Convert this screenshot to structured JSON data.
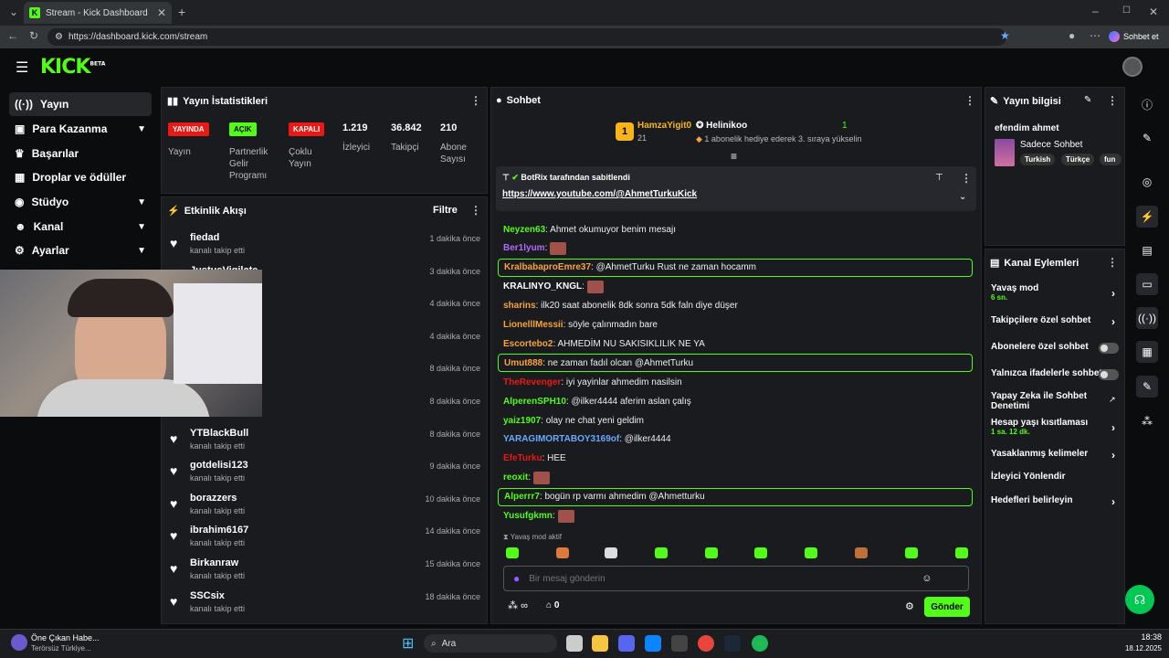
{
  "browser": {
    "tab_title": "Stream - Kick Dashboard",
    "tab_favicon": "K",
    "url": "https://dashboard.kick.com/stream",
    "chat_button": "Sohbet et"
  },
  "header": {
    "logo": "KICK",
    "logo_badge": "BETA"
  },
  "sidebar": {
    "items": [
      {
        "label": "Yayın",
        "icon": "broadcast-icon"
      },
      {
        "label": "Para Kazanma",
        "icon": "wallet-icon"
      },
      {
        "label": "Başarılar",
        "icon": "trophy-icon"
      },
      {
        "label": "Droplar ve ödüller",
        "icon": "gift-icon"
      },
      {
        "label": "Stüdyo",
        "icon": "palette-icon"
      },
      {
        "label": "Kanal",
        "icon": "people-icon"
      },
      {
        "label": "Ayarlar",
        "icon": "gear-icon"
      }
    ]
  },
  "stats": {
    "title": "Yayın İstatistikleri",
    "badges": [
      {
        "text": "YAYINDA",
        "label": "Yayın",
        "color": "#e91916"
      },
      {
        "text": "AÇIK",
        "label": "Partnerlik Gelir Programı",
        "color": "#53fc18"
      },
      {
        "text": "KAPALI",
        "label": "Çoklu Yayın",
        "color": "#e91916"
      }
    ],
    "values": [
      {
        "value": "1.219",
        "label": "İzleyici"
      },
      {
        "value": "36.842",
        "label": "Takipçi"
      },
      {
        "value": "210",
        "label": "Abone Sayısı"
      }
    ]
  },
  "activity": {
    "title": "Etkinlik Akışı",
    "filter": "Filtre",
    "rows": [
      {
        "name": "fiedad",
        "sub": "kanalı takip etti",
        "time": "1 dakika önce"
      },
      {
        "name": "JustusVigilate",
        "sub": "kanalı takip etti",
        "time": "3 dakika önce"
      },
      {
        "name": "",
        "sub": "",
        "time": "4 dakika önce"
      },
      {
        "name": "",
        "sub": "",
        "time": "4 dakika önce"
      },
      {
        "name": "",
        "sub": "",
        "time": "8 dakika önce"
      },
      {
        "name": "",
        "sub": "",
        "time": "8 dakika önce"
      },
      {
        "name": "YTBlackBull",
        "sub": "kanalı takip etti",
        "time": "8 dakika önce"
      },
      {
        "name": "gotdelisi123",
        "sub": "kanalı takip etti",
        "time": "9 dakika önce"
      },
      {
        "name": "borazzers",
        "sub": "kanalı takip etti",
        "time": "10 dakika önce"
      },
      {
        "name": "ibrahim6167",
        "sub": "kanalı takip etti",
        "time": "14 dakika önce"
      },
      {
        "name": "Birkanraw",
        "sub": "kanalı takip etti",
        "time": "15 dakika önce"
      },
      {
        "name": "SSCsix",
        "sub": "kanalı takip etti",
        "time": "18 dakika önce"
      }
    ]
  },
  "chat": {
    "title": "Sohbet",
    "gifter_rank": "1",
    "gifter_name": "HamzaYigit0",
    "gifter_count": "21",
    "gift_user": "Helinikoo",
    "gift_count": "1",
    "gift_text": "1 abonelik hediye ederek 3. sıraya yükselin",
    "pinned_by": "BotRix tarafından sabitlendi",
    "pinned_link": "https://www.youtube.com/@AhmetTurkuKick",
    "messages": [
      {
        "user": "Neyzen63",
        "color": "#53fc18",
        "text": ": Ahmet okumuyor benim mesajı",
        "hl": false,
        "emote": false
      },
      {
        "user": "Ber1lyum",
        "color": "#b06cf8",
        "text": ":",
        "hl": false,
        "emote": true
      },
      {
        "user": "KralbabaproEmre37",
        "color": "#f8a33b",
        "text": ": @AhmetTurku Rust ne zaman hocamm",
        "hl": true,
        "emote": false
      },
      {
        "user": "KRALINYO_KNGL",
        "color": "#ffffff",
        "text": ":",
        "hl": false,
        "emote": true
      },
      {
        "user": "sharins",
        "color": "#f8a33b",
        "text": ": ilk20 saat abonelik 8dk sonra 5dk faln diye düşer",
        "hl": false,
        "emote": false
      },
      {
        "user": "LionelllMessii",
        "color": "#f8a33b",
        "text": ": söyle çalınmadın bare",
        "hl": false,
        "emote": false
      },
      {
        "user": "Escortebo2",
        "color": "#f8a33b",
        "text": ": AHMEDİM NU SAKISIKLILIK NE YA",
        "hl": false,
        "emote": false
      },
      {
        "user": "Umut888",
        "color": "#f8a33b",
        "text": ": ne zaman fadıl olcan @AhmetTurku",
        "hl": true,
        "emote": false
      },
      {
        "user": "TheRevenger",
        "color": "#e91916",
        "text": ": iyi yayinlar ahmedim nasilsin",
        "hl": false,
        "emote": false
      },
      {
        "user": "AlperenSPH10",
        "color": "#53fc18",
        "text": ": @ilker4444 aferim aslan çalış",
        "hl": false,
        "emote": false
      },
      {
        "user": "yaiz1907",
        "color": "#53fc18",
        "text": ": olay ne chat yeni geldim",
        "hl": false,
        "emote": false
      },
      {
        "user": "YARAGIMORTABOY3169of",
        "color": "#6aa9ff",
        "text": ": @ilker4444",
        "hl": false,
        "emote": false
      },
      {
        "user": "EfeTurku",
        "color": "#e91916",
        "text": ": HEE",
        "hl": false,
        "emote": false
      },
      {
        "user": "reoxit",
        "color": "#53fc18",
        "text": ":",
        "hl": false,
        "emote": true
      },
      {
        "user": "Alperrr7",
        "color": "#53fc18",
        "text": ": bogün rp varmı ahmedim @Ahmetturku",
        "hl": true,
        "emote": false
      },
      {
        "user": "Yusufgkmn",
        "color": "#53fc18",
        "text": ":",
        "hl": false,
        "emote": true
      }
    ],
    "slow_mode_note": "Yavaş mod aktif",
    "input_placeholder": "Bir mesaj gönderin",
    "points": "∞",
    "store_count": "0",
    "send_label": "Gönder"
  },
  "info": {
    "title": "Yayın bilgisi",
    "stream_title": "efendim ahmet",
    "category": "Sadece Sohbet",
    "tags": [
      "Turkish",
      "Türkçe",
      "fun"
    ]
  },
  "actions": {
    "title": "Kanal Eylemleri",
    "items": [
      {
        "label": "Yavaş mod",
        "sub": "6 sn.",
        "type": "chevron"
      },
      {
        "label": "Takipçilere özel sohbet",
        "sub": "",
        "type": "chevron"
      },
      {
        "label": "Abonelere özel sohbet",
        "sub": "",
        "type": "toggle"
      },
      {
        "label": "Yalnızca ifadelerle sohbet",
        "sub": "",
        "type": "toggle"
      },
      {
        "label": "Yapay Zeka ile Sohbet Denetimi",
        "sub": "",
        "type": "external"
      },
      {
        "label": "Hesap yaşı kısıtlaması",
        "sub": "1 sa. 12 dk.",
        "type": "chevron"
      },
      {
        "label": "Yasaklanmış kelimeler",
        "sub": "",
        "type": "chevron"
      },
      {
        "label": "İzleyici Yönlendir",
        "sub": "",
        "type": "none"
      },
      {
        "label": "Hedefleri belirleyin",
        "sub": "",
        "type": "chevron"
      }
    ]
  },
  "taskbar": {
    "news_title": "Öne Çıkan Habe...",
    "news_sub": "Terörsüz Türkiye...",
    "search": "Ara",
    "time": "18:38",
    "date": "18.12.2025"
  }
}
